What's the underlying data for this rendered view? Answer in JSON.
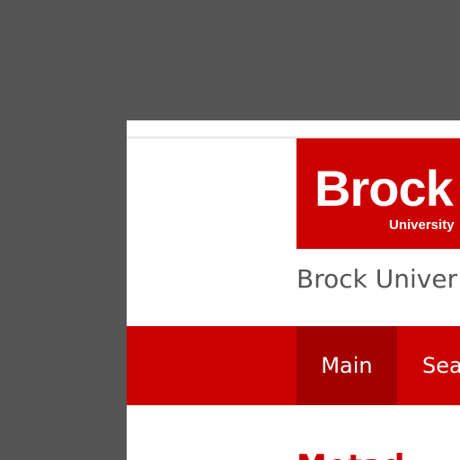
{
  "theme": {
    "brand_red": "#cc0000",
    "active_tab_red": "#a30000",
    "backdrop_gray": "#555555"
  },
  "logo": {
    "wordmark": "Brock",
    "subtitle": "University",
    "icon": "fingerprint-icon"
  },
  "header": {
    "site_name": "Brock Univer"
  },
  "nav": {
    "items": [
      {
        "label": "Main",
        "active": true
      },
      {
        "label": "Sea",
        "active": false
      }
    ]
  },
  "main": {
    "heading_fragment": "Metad"
  }
}
